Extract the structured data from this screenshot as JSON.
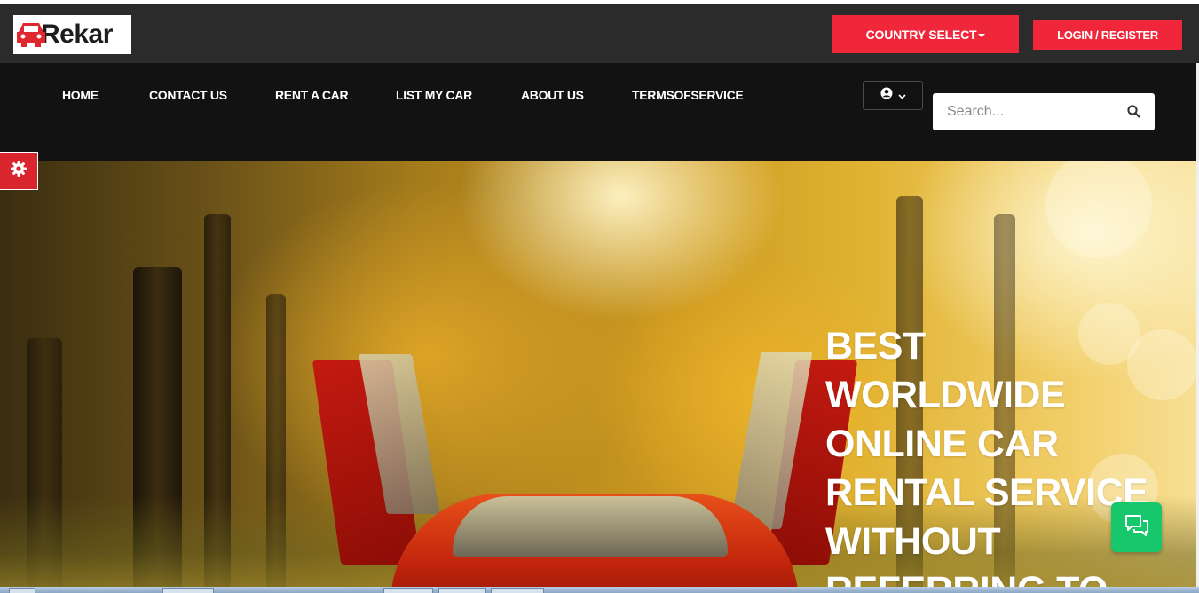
{
  "header": {
    "logo_text": "Rekar",
    "country_select_label": "COUNTRY SELECT",
    "login_register_label": "LOGIN / REGISTER"
  },
  "nav": {
    "items": [
      {
        "label": "HOME"
      },
      {
        "label": "CONTACT US"
      },
      {
        "label": "RENT A CAR"
      },
      {
        "label": "LIST MY CAR"
      },
      {
        "label": "ABOUT US"
      },
      {
        "label": "TERMSOFSERVICE"
      }
    ],
    "user_menu_icon": "user-circle-icon",
    "search_placeholder": "Search...",
    "search_icon": "search-icon"
  },
  "hero": {
    "headline_lines": [
      "BEST",
      "WORLDWIDE",
      "ONLINE CAR",
      "RENTAL SERVICE",
      "WITHOUT",
      "REFERRING TO"
    ]
  },
  "widgets": {
    "settings_icon": "gear-icon",
    "chat_icon": "chat-icon"
  },
  "colors": {
    "accent_red": "#f0263a",
    "topbar": "#2b2b2b",
    "navbar": "#121212",
    "chat_green": "#17c76b"
  }
}
